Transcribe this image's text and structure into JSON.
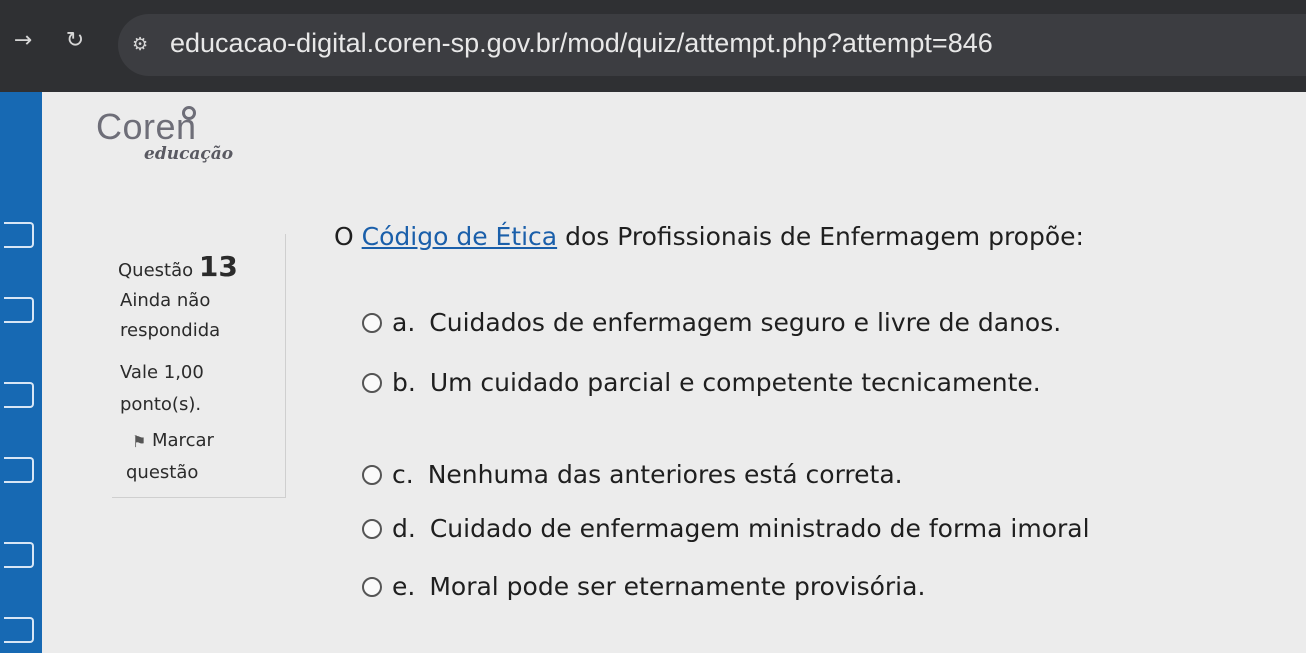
{
  "browser": {
    "back_icon": "arrow-right-icon",
    "reload_icon": "reload-icon",
    "url": "educacao-digital.coren-sp.gov.br/mod/quiz/attempt.php?attempt=846"
  },
  "logo": {
    "name": "Coren",
    "tagline": "educação"
  },
  "info": {
    "question_label": "Questão",
    "question_number": "13",
    "status_line1": "Ainda não",
    "status_line2": "respondida",
    "value_line1": "Vale 1,00",
    "value_line2": "ponto(s).",
    "flag_line1": "Marcar",
    "flag_line2": "questão"
  },
  "question": {
    "prefix": "O",
    "link_text": "Código de Ética",
    "suffix": "dos Profissionais de Enfermagem propõe:"
  },
  "options": [
    {
      "letter": "a.",
      "text": "Cuidados de enfermagem seguro e livre de danos."
    },
    {
      "letter": "b.",
      "text": "Um cuidado parcial e competente tecnicamente."
    },
    {
      "letter": "c.",
      "text": "Nenhuma das anteriores está correta."
    },
    {
      "letter": "d.",
      "text": "Cuidado de enfermagem ministrado de forma imoral"
    },
    {
      "letter": "e.",
      "text": "Moral pode ser eternamente provisória."
    }
  ],
  "colors": {
    "rail": "#1769b3",
    "link": "#1a5faa",
    "browser_bar": "#2f3033"
  }
}
